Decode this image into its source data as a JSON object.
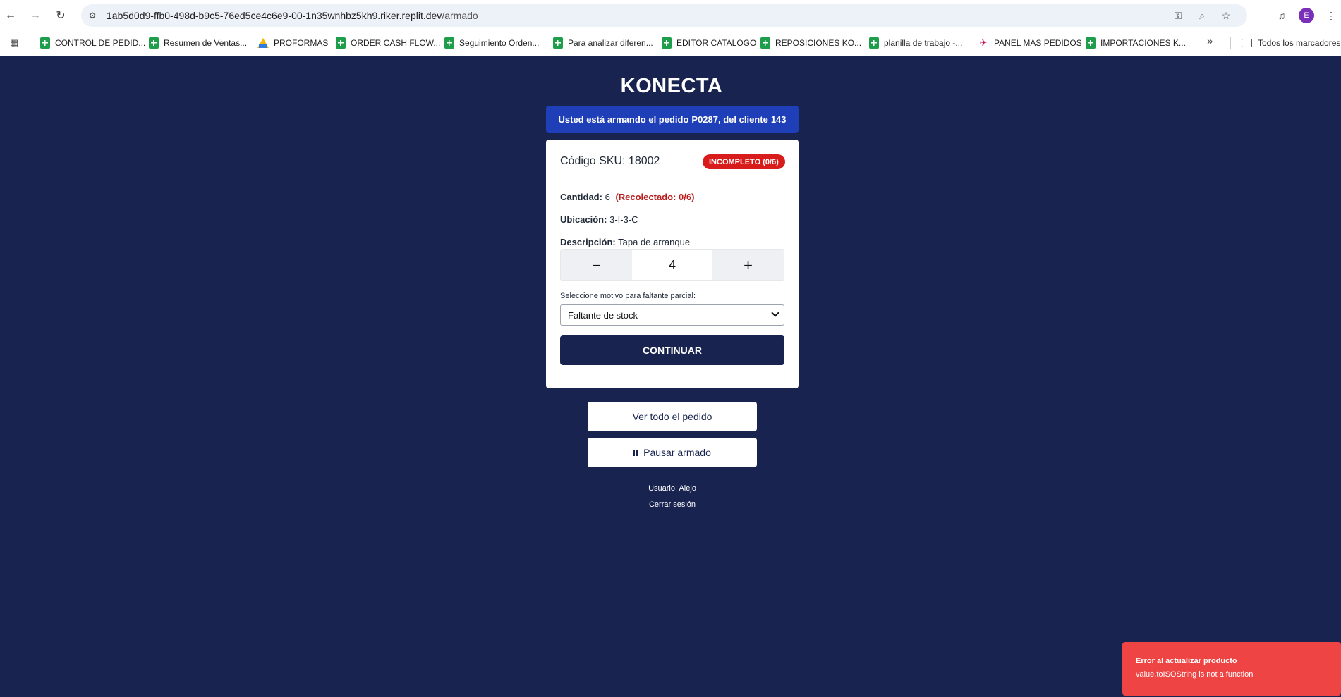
{
  "browser": {
    "url_host": "1ab5d0d9-ffb0-498d-b9c5-76ed5ce4c6e9-00-1n35wnhbz5kh9.riker.replit.dev",
    "url_path": "/armado",
    "avatar_letter": "E",
    "bookmarks": [
      {
        "label": "CONTROL DE PEDID...",
        "icon": "sheets-icon"
      },
      {
        "label": "Resumen de Ventas...",
        "icon": "sheets-icon"
      },
      {
        "label": "PROFORMAS",
        "icon": "drive-icon"
      },
      {
        "label": "ORDER CASH FLOW...",
        "icon": "sheets-icon"
      },
      {
        "label": "Seguimiento Orden...",
        "icon": "sheets-icon"
      },
      {
        "label": "Para analizar diferen...",
        "icon": "sheets-icon"
      },
      {
        "label": "EDITOR CATALOGO",
        "icon": "sheets-icon"
      },
      {
        "label": "REPOSICIONES KO...",
        "icon": "sheets-icon"
      },
      {
        "label": "planilla de trabajo -...",
        "icon": "sheets-icon"
      },
      {
        "label": "PANEL MAS PEDIDOS",
        "icon": "plane-icon"
      },
      {
        "label": "IMPORTACIONES K...",
        "icon": "sheets-icon"
      }
    ],
    "bookmarks_folder": "Todos los marcadores"
  },
  "app": {
    "title": "KONECTA",
    "banner_prefix": "Usted está armando el pedido",
    "order_id": "P0287",
    "banner_mid": ", del cliente",
    "client_id": "143"
  },
  "product": {
    "sku_label": "Código SKU:",
    "sku": "18002",
    "status": "INCOMPLETO (0/6)",
    "quantity_label": "Cantidad:",
    "quantity": "6",
    "collected": "(Recolectado: 0/6)",
    "location_label": "Ubicación:",
    "location": "3-I-3-C",
    "description_label": "Descripción:",
    "description": "Tapa de arranque"
  },
  "stepper": {
    "minus": "−",
    "value": "4",
    "plus": "+"
  },
  "reason": {
    "label": "Seleccione motivo para faltante parcial:",
    "selected": "Faltante de stock"
  },
  "actions": {
    "continue": "CONTINUAR",
    "view_order": "Ver todo el pedido",
    "pause": "Pausar armado"
  },
  "footer": {
    "user": "Usuario: Alejo",
    "logout": "Cerrar sesión"
  },
  "toast": {
    "title": "Error al actualizar producto",
    "message": "value.toISOString is not a function"
  },
  "colors": {
    "page_bg": "#18244f",
    "banner": "#1f3fb8",
    "badge": "#d81b1b",
    "toast": "#ef4444"
  }
}
